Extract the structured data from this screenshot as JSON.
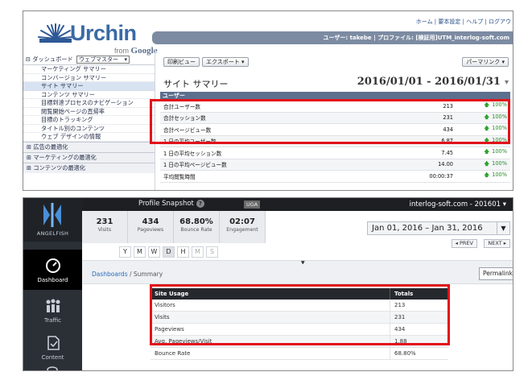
{
  "urchin": {
    "logo": {
      "word": "Urchin",
      "from": "from",
      "brand": "Google"
    },
    "top_links": "ホーム | 要本設定 | ヘルプ | ログアウ",
    "user_bar": "ユーザー: takebe | プロファイル: [検証用]UTM_interlog-soft.com",
    "sidebar": {
      "dashboard_label": "ダッシュボード",
      "dashboard_select": "ウェブマスター",
      "items": [
        "マーケティング サマリー",
        "コンバージョン サマリー",
        "サイト サマリー",
        "コンテンツ サマリー",
        "目標到達プロセスのナビゲーション",
        "閲覧開始ページの直帰率",
        "目標のトラッキング",
        "タイトル別のコンテンツ",
        "ウェブ デザインの情報"
      ],
      "sections": [
        "広告の最適化",
        "マーケティングの最適化",
        "コンテンツの最適化"
      ]
    },
    "toolbar": {
      "print": "印刷ビュー",
      "export": "エクスポート ▾",
      "permalink": "パーマリンク ▾"
    },
    "title": "サイト サマリー",
    "date_range": "2016/01/01 - 2016/01/31",
    "table_header": "ユーザー",
    "rows": [
      {
        "label": "合計ユーザー数",
        "value": "213",
        "pct": "100%",
        "arrow": true
      },
      {
        "label": "合計セッション数",
        "value": "231",
        "pct": "100%",
        "arrow": true
      },
      {
        "label": "合計ページビュー数",
        "value": "434",
        "pct": "100%",
        "arrow": true
      },
      {
        "label": "1 日の平均ユーザー数",
        "value": "6.87",
        "pct": "100%",
        "arrow": true
      },
      {
        "label": "1 日の平均セッション数",
        "value": "7.45",
        "pct": "100%",
        "arrow": true
      },
      {
        "label": "1 日の平均ページビュー数",
        "value": "14.00",
        "pct": "100%",
        "arrow": true
      },
      {
        "label": "平均閲覧時間",
        "value": "00:00:37",
        "pct": "100%",
        "arrow": true
      }
    ],
    "accent_red": "#e2101a"
  },
  "angelfish": {
    "logo_text": "ANGELFISH",
    "nav": [
      {
        "label": "Dashboard",
        "icon": "dashboard-gauge-icon",
        "active": true
      },
      {
        "label": "Traffic",
        "icon": "people-icon",
        "active": false
      },
      {
        "label": "Content",
        "icon": "content-icon",
        "active": false
      }
    ],
    "snapshot_title": "Profile Snapshot",
    "snapshot_help": "?",
    "uga_badge": "UGA",
    "site": "interlog-soft.com - 201601 ▾",
    "stats": [
      {
        "num": "231",
        "cap": "Visits"
      },
      {
        "num": "434",
        "cap": "Pageviews"
      },
      {
        "num": "68.80%",
        "cap": "Bounce Rate"
      },
      {
        "num": "02:07",
        "cap": "Engagement"
      }
    ],
    "date_range": "Jan 01, 2016 – Jan 31, 2016",
    "prev_label": "◂ PREV",
    "next_label": "NEXT ▸",
    "periods": [
      {
        "label": "Y",
        "state": "normal"
      },
      {
        "label": "M",
        "state": "normal"
      },
      {
        "label": "W",
        "state": "normal"
      },
      {
        "label": "D",
        "state": "on"
      },
      {
        "label": "H",
        "state": "normal"
      },
      {
        "label": "M",
        "state": "dim"
      },
      {
        "label": "S",
        "state": "dim"
      }
    ],
    "breadcrumb": {
      "link": "Dashboards",
      "sep": " / ",
      "current": "Summary"
    },
    "permalink": "Permalink",
    "table": {
      "headers": [
        "Site Usage",
        "Totals"
      ],
      "rows": [
        [
          "Visitors",
          "213"
        ],
        [
          "Visits",
          "231"
        ],
        [
          "Pageviews",
          "434"
        ],
        [
          "Avg. Pageviews/Visit",
          "1.88"
        ],
        [
          "Bounce Rate",
          "68.80%"
        ]
      ]
    }
  }
}
